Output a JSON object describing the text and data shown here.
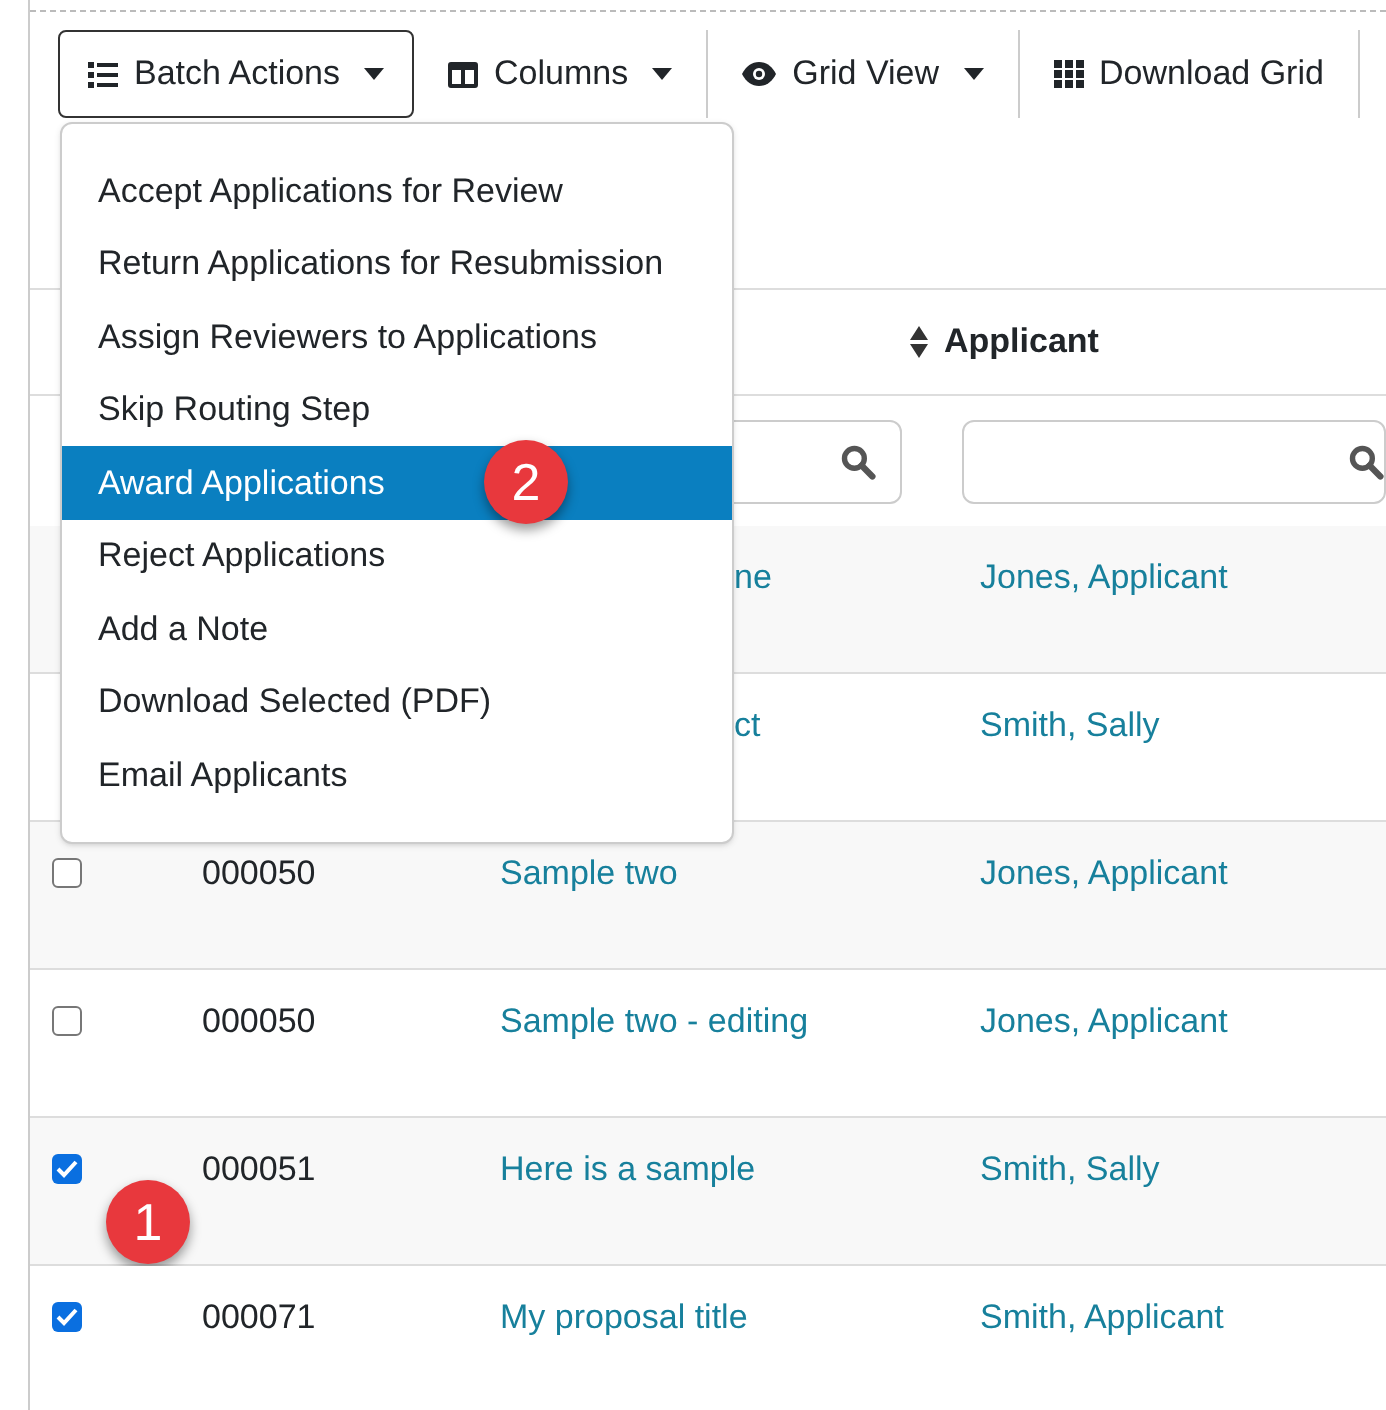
{
  "toolbar": [
    {
      "kind": "list",
      "label": "Batch Actions",
      "dropdown": true,
      "selected": true
    },
    {
      "kind": "columns",
      "label": "Columns",
      "dropdown": true,
      "selected": false
    },
    {
      "kind": "eye",
      "label": "Grid View",
      "dropdown": true,
      "selected": false
    },
    {
      "kind": "grid",
      "label": "Download Grid",
      "dropdown": false,
      "selected": false
    }
  ],
  "menu": [
    {
      "label": "Accept Applications for Review",
      "selected": false
    },
    {
      "label": "Return Applications for Resubmission",
      "selected": false
    },
    {
      "label": "Assign Reviewers to Applications",
      "selected": false
    },
    {
      "label": "Skip Routing Step",
      "selected": false
    },
    {
      "label": "Award Applications",
      "selected": true,
      "badge": "2"
    },
    {
      "label": "Reject Applications",
      "selected": false
    },
    {
      "label": "Add a Note",
      "selected": false
    },
    {
      "label": "Download Selected (PDF)",
      "selected": false
    },
    {
      "label": "Email Applicants",
      "selected": false
    }
  ],
  "table": {
    "columns": [
      {
        "label": "Applicant",
        "sortable": true
      }
    ],
    "rows": [
      {
        "covered": true,
        "title": "ne",
        "applicant": "Jones, Applicant"
      },
      {
        "covered": true,
        "title": "ct",
        "applicant": "Smith, Sally"
      },
      {
        "covered": false,
        "checked": false,
        "id": "000050",
        "title": "Sample two",
        "applicant": "Jones, Applicant"
      },
      {
        "covered": false,
        "checked": false,
        "id": "000050",
        "title": "Sample two - editing",
        "applicant": "Jones, Applicant"
      },
      {
        "covered": false,
        "checked": true,
        "id": "000051",
        "title": "Here is a sample",
        "applicant": "Smith, Sally",
        "badge": "1"
      },
      {
        "covered": false,
        "checked": true,
        "id": "000071",
        "title": "My proposal title",
        "applicant": "Smith, Applicant"
      }
    ]
  }
}
